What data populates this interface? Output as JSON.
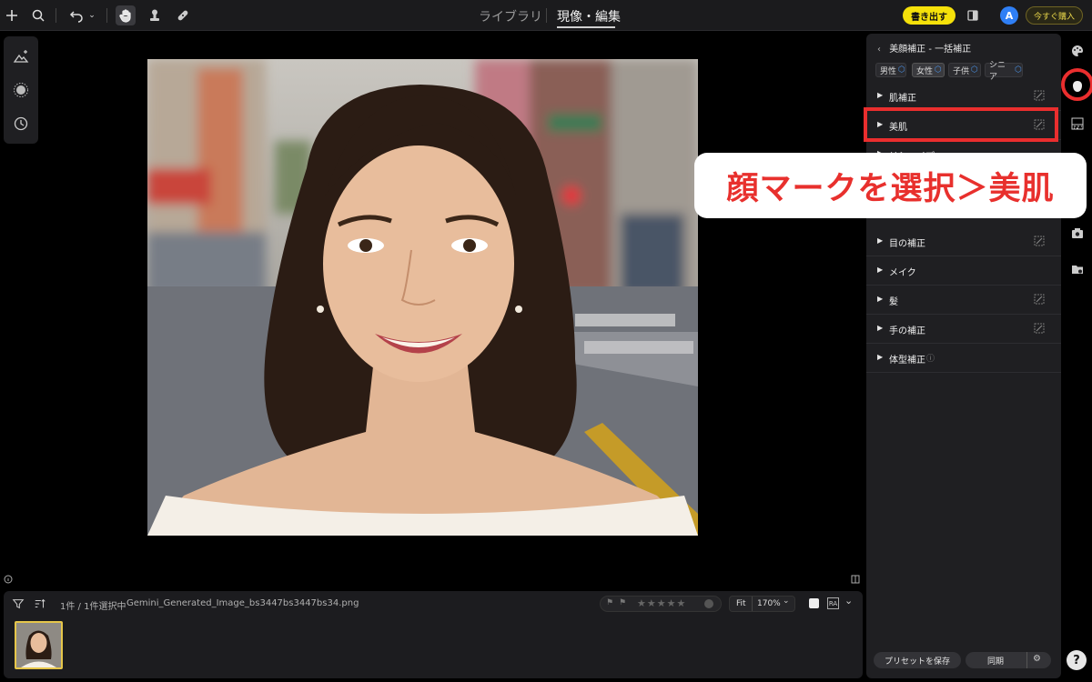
{
  "topbar": {
    "tabs": [
      "ライブラリ",
      "現像・編集"
    ],
    "active_tab": "現像・編集",
    "export_label": "書き出す",
    "avatar_initial": "A",
    "buy_label": "今すぐ購入"
  },
  "filmstrip": {
    "selection_count": "1件 / 1件選択中",
    "filename": "Gemini_Generated_Image_bs3447bs3447bs34.png",
    "fit_label": "Fit",
    "zoom_level": "170%",
    "star_rating": 0
  },
  "panel": {
    "title": "美顔補正 - 一括補正",
    "chips": [
      "男性",
      "女性",
      "子供",
      "シニア"
    ],
    "selected_chip": "女性",
    "sections": [
      "肌補正",
      "美肌",
      "リシェイプ",
      "目の補正",
      "メイク",
      "髪",
      "手の補正",
      "体型補正"
    ],
    "save_preset_label": "プリセットを保存",
    "sync_label": "同期"
  },
  "annotation": {
    "callout_text": "顔マークを選択＞美肌",
    "highlight_color": "#ea2e2e"
  },
  "colors": {
    "accent_yellow": "#f5e10a",
    "avatar_blue": "#2f7ff5"
  },
  "icons": {
    "left_tools": [
      "mountain-sparkle-icon",
      "sparkle-circle-icon",
      "history-icon"
    ],
    "right_strip": [
      "palette-icon",
      "face-icon",
      "gradient-icon",
      "camera-icon",
      "folder-settings-icon"
    ]
  }
}
